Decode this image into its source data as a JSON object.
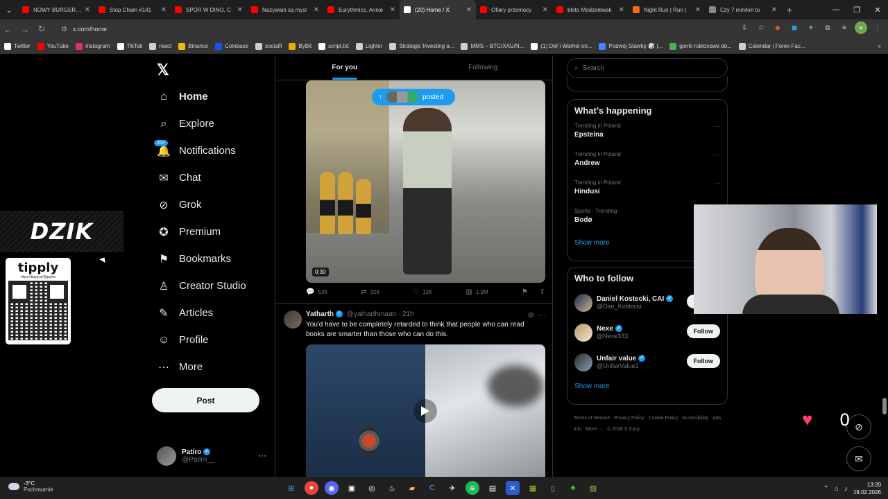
{
  "browser": {
    "tabs": [
      {
        "title": "NOWY BURGER W",
        "color": "#ff0000"
      },
      {
        "title": "Stop Cham #141",
        "color": "#ff0000"
      },
      {
        "title": "SPÓR W DINO, C",
        "color": "#ff0000"
      },
      {
        "title": "Nazywani są mysl",
        "color": "#ff0000"
      },
      {
        "title": "Eurythmics, Annie",
        "color": "#ff0000"
      },
      {
        "title": "(20) Home / X",
        "color": "#ffffff",
        "active": true
      },
      {
        "title": "Ofiary przemocy",
        "color": "#ff0000"
      },
      {
        "title": "błoto Modzelewsk",
        "color": "#ff0000"
      },
      {
        "title": "Night Run | Run |",
        "color": "#f26c1b"
      },
      {
        "title": "Czy 7 min/km to",
        "color": "#888888"
      }
    ],
    "url": "x.com/home",
    "bookmarks": [
      "Twitter",
      "YouTube",
      "Instagram",
      "TikTok",
      "react",
      "Binance",
      "Coinbase",
      "socialfi",
      "ByBit",
      "script.txt",
      "Lighter",
      "Strategic Investing a...",
      "MMS – BTC/XAU/N...",
      "(1) DeFi Warhol on...",
      "Podwój Stawkę 🎲 |...",
      "gierki robloxowe do...",
      "Calendar | Forex Fac..."
    ]
  },
  "overlay": {
    "dzik": "DZIK",
    "tipply_title": "tipply",
    "tipply_url": "https://tipply.pl/@patiro"
  },
  "nav": {
    "items": [
      {
        "label": "Home",
        "icon": "home-icon",
        "glyph": "⌂"
      },
      {
        "label": "Explore",
        "icon": "search-icon",
        "glyph": "⌕"
      },
      {
        "label": "Notifications",
        "icon": "bell-icon",
        "glyph": "🔔"
      },
      {
        "label": "Chat",
        "icon": "mail-icon",
        "glyph": "✉"
      },
      {
        "label": "Grok",
        "icon": "grok-icon",
        "glyph": "⊘"
      },
      {
        "label": "Premium",
        "icon": "premium-icon",
        "glyph": "✪"
      },
      {
        "label": "Bookmarks",
        "icon": "bookmark-icon",
        "glyph": "⚑"
      },
      {
        "label": "Creator Studio",
        "icon": "creator-icon",
        "glyph": "♙"
      },
      {
        "label": "Articles",
        "icon": "articles-icon",
        "glyph": "✎"
      },
      {
        "label": "Profile",
        "icon": "profile-icon",
        "glyph": "☺"
      },
      {
        "label": "More",
        "icon": "more-icon",
        "glyph": "⋯"
      }
    ],
    "notif_badge": "20+",
    "post_label": "Post",
    "account_name": "Patiro",
    "account_handle": "@Patiro__"
  },
  "feed": {
    "tab_for_you": "For you",
    "tab_following": "Following",
    "posted_label": "posted",
    "video1_duration": "0:30",
    "tweet1_stats": {
      "replies": "536",
      "reposts": "329",
      "likes": "12K",
      "views": "1.9M"
    },
    "tweet2": {
      "name": "Yatharth",
      "handle": "@yatharthmaan",
      "time": "21h",
      "text": "You'd have to be completely retarded to think that people who can read books are smarter than those who can do this."
    }
  },
  "sidebar": {
    "search_placeholder": "Search",
    "happening_title": "What’s happening",
    "trends": [
      {
        "context": "Trending in Poland",
        "name": "Epsteina"
      },
      {
        "context": "Trending in Poland",
        "name": "Andrew"
      },
      {
        "context": "Trending in Poland",
        "name": "Hindusi"
      },
      {
        "context": "Sports · Trending",
        "name": "Bodø"
      }
    ],
    "show_more": "Show more",
    "who_title": "Who to follow",
    "who": [
      {
        "name": "Daniel Kostecki, CAI",
        "handle": "@Dan_Kostecki",
        "follow": "Follow"
      },
      {
        "name": "Nexe",
        "handle": "@Nexe333",
        "follow": "Follow"
      },
      {
        "name": "Unfair value",
        "handle": "@UnfairValue1",
        "follow": "Follow"
      }
    ],
    "footer": [
      "Terms of Service",
      "Privacy Policy",
      "Cookie Policy",
      "Accessibility",
      "Ads info",
      "More ···",
      "© 2026 X Corp."
    ]
  },
  "stream": {
    "counter": "0"
  },
  "taskbar": {
    "temp": "-3°C",
    "weather": "Pochmurnie",
    "time": "13:20",
    "date": "19.02.2026"
  },
  "colors": {
    "accent": "#1d9bf0",
    "bg": "#000000",
    "border": "#2f3336"
  }
}
